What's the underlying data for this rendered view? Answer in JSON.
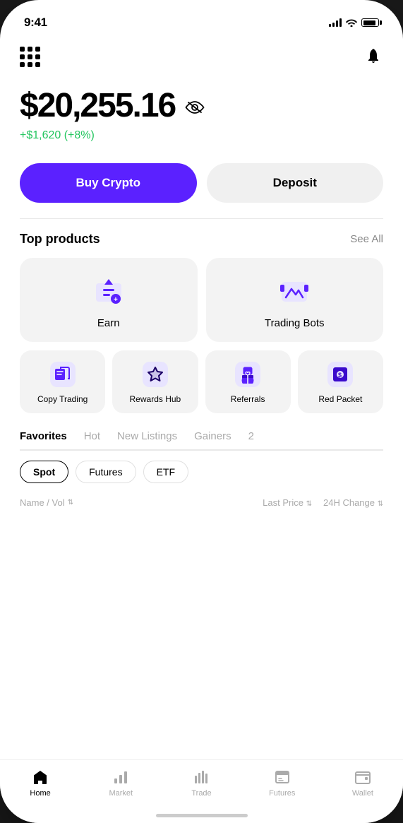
{
  "status": {
    "time": "9:41"
  },
  "header": {
    "balance": "$20,255.16",
    "change": "+$1,620 (+8%)"
  },
  "actions": {
    "buy_label": "Buy Crypto",
    "deposit_label": "Deposit"
  },
  "top_products": {
    "title": "Top products",
    "see_all": "See All",
    "large_cards": [
      {
        "label": "Earn"
      },
      {
        "label": "Trading Bots"
      }
    ],
    "small_cards": [
      {
        "label": "Copy Trading"
      },
      {
        "label": "Rewards Hub"
      },
      {
        "label": "Referrals"
      },
      {
        "label": "Red Packet"
      }
    ]
  },
  "tabs": [
    {
      "label": "Favorites",
      "active": true
    },
    {
      "label": "Hot",
      "active": false
    },
    {
      "label": "New Listings",
      "active": false
    },
    {
      "label": "Gainers",
      "active": false
    },
    {
      "label": "2",
      "active": false
    }
  ],
  "filters": [
    {
      "label": "Spot",
      "active": true
    },
    {
      "label": "Futures",
      "active": false
    },
    {
      "label": "ETF",
      "active": false
    }
  ],
  "table_header": {
    "left": "Name / Vol",
    "right_price": "Last Price",
    "right_change": "24H Change"
  },
  "bottom_nav": [
    {
      "label": "Home",
      "active": true
    },
    {
      "label": "Market",
      "active": false
    },
    {
      "label": "Trade",
      "active": false
    },
    {
      "label": "Futures",
      "active": false
    },
    {
      "label": "Wallet",
      "active": false
    }
  ]
}
